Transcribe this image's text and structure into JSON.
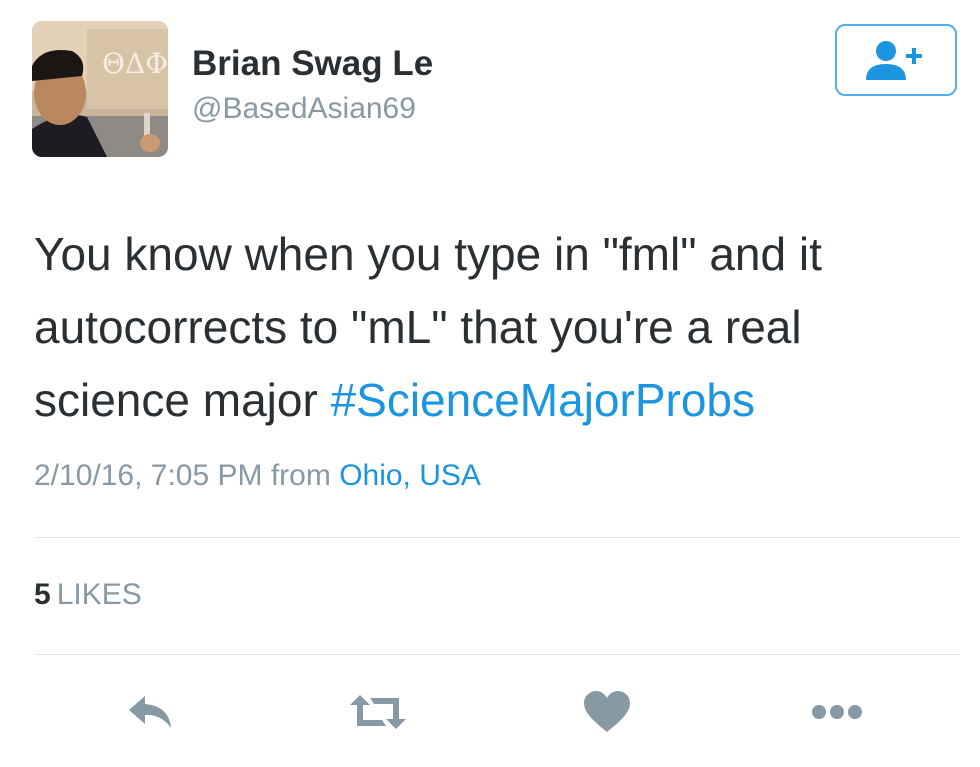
{
  "tweet": {
    "display_name": "Brian Swag Le",
    "handle": "@BasedAsian69",
    "avatar_text": "ΘΔΦ",
    "text_lines": [
      "You know when you type in \"fml\" and it",
      "autocorrects to \"mL\" that you're a real",
      "science major "
    ],
    "hashtag": "#ScienceMajorProbs",
    "timestamp": "2/10/16, 7:05 PM",
    "from_label": "from",
    "location": "Ohio, USA",
    "likes_count": "5",
    "likes_label": "LIKES"
  },
  "icons": {
    "follow": "add-user-icon",
    "reply": "reply-icon",
    "retweet": "retweet-icon",
    "like": "heart-icon",
    "more": "more-icon"
  },
  "colors": {
    "accent": "#1b95e0",
    "follow_border": "#55acee",
    "action_icon": "#8899a6",
    "secondary_text": "#8899a6",
    "primary_text": "#292f33",
    "divider": "#e1e8ed"
  }
}
